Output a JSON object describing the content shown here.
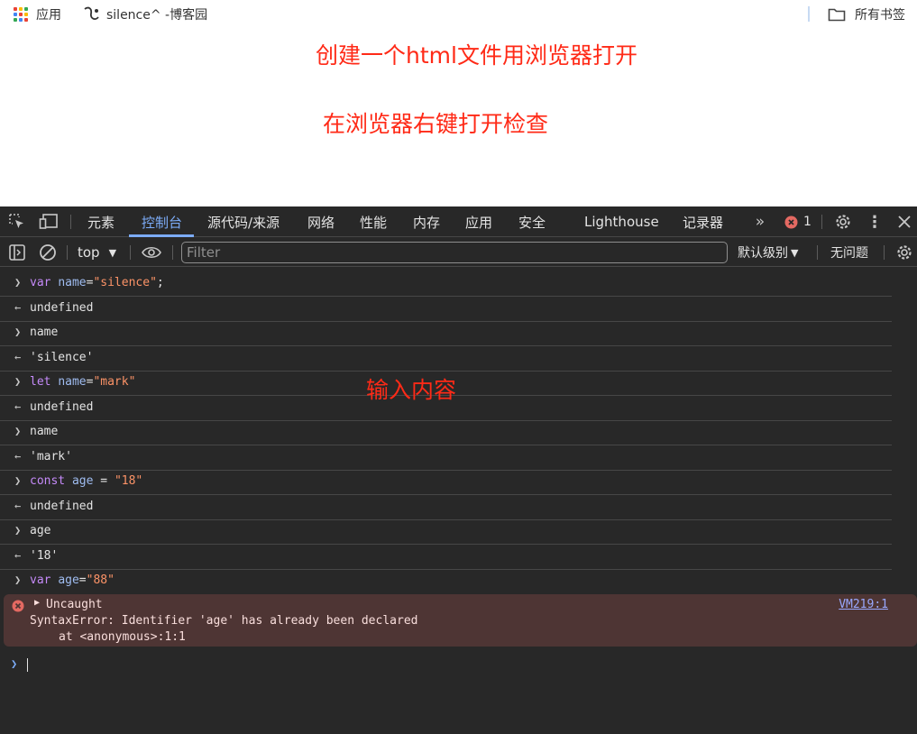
{
  "bookmarks": {
    "apps_label": "应用",
    "site_label": "silence^ -博客园",
    "all_bookmarks_label": "所有书签"
  },
  "annotations": {
    "step1": "创建一个html文件用浏览器打开",
    "step2": "在浏览器右键打开检查",
    "step3": "输入内容"
  },
  "devtools": {
    "tabs": [
      "元素",
      "控制台",
      "源代码/来源",
      "网络",
      "性能",
      "内存",
      "应用",
      "安全",
      "Lighthouse",
      "记录器"
    ],
    "active_tab": "控制台",
    "error_count": "1",
    "toolbar": {
      "context": "top",
      "filter_placeholder": "Filter",
      "levels_label": "默认级别",
      "issues_label": "无问题"
    }
  },
  "console": {
    "entries": [
      {
        "type": "input",
        "text": "var name=\"silence\";"
      },
      {
        "type": "output",
        "text": "undefined"
      },
      {
        "type": "input",
        "text": "name"
      },
      {
        "type": "output",
        "text": "'silence'"
      },
      {
        "type": "input",
        "text": "let name=\"mark\""
      },
      {
        "type": "output",
        "text": "undefined"
      },
      {
        "type": "input",
        "text": "name"
      },
      {
        "type": "output",
        "text": "'mark'"
      },
      {
        "type": "input",
        "text": "const age = \"18\""
      },
      {
        "type": "output",
        "text": "undefined"
      },
      {
        "type": "input",
        "text": "age"
      },
      {
        "type": "output",
        "text": "'18'"
      },
      {
        "type": "input",
        "text": "var age=\"88\""
      }
    ],
    "error": {
      "title": "Uncaught",
      "message": "SyntaxError: Identifier 'age' has already been declared",
      "stack": "at <anonymous>:1:1",
      "source_link": "VM219:1"
    }
  },
  "colors": {
    "annotation": "#ff2a17",
    "devtools_bg": "#282828",
    "active_tab": "#7cacf8",
    "error_bg": "#4e3534"
  }
}
